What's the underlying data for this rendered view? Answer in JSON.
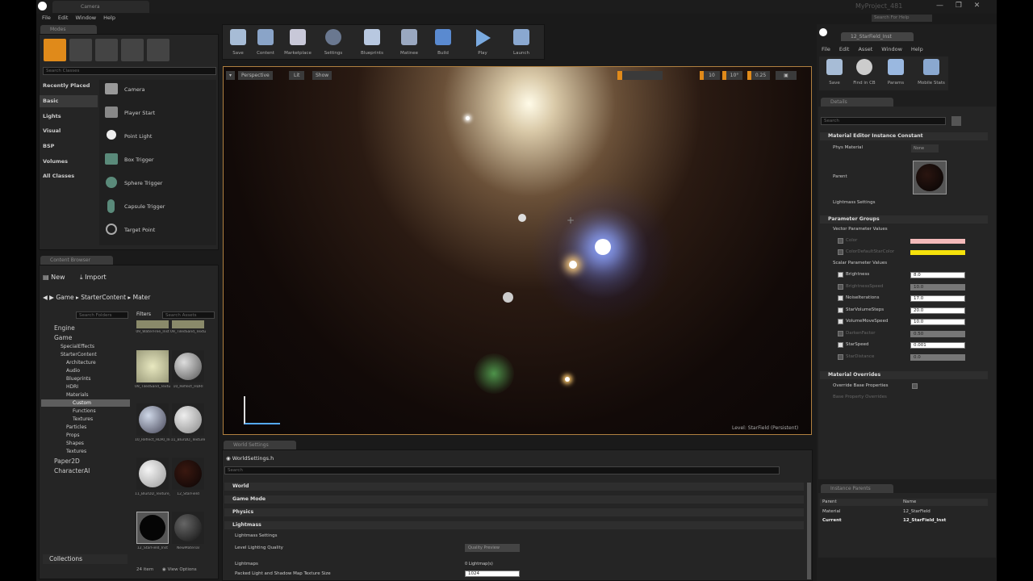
{
  "window": {
    "project_title": "MyProject_481",
    "tab_label": "Camera",
    "search_placeholder": "Search For Help"
  },
  "menu": [
    "File",
    "Edit",
    "Window",
    "Help"
  ],
  "modes": {
    "tab": "Modes",
    "search_placeholder": "Search Classes",
    "categories": [
      "Recently Placed",
      "Basic",
      "Lights",
      "Visual",
      "BSP",
      "Volumes",
      "All Classes"
    ],
    "items": [
      "Camera",
      "Player Start",
      "Point Light",
      "Box Trigger",
      "Sphere Trigger",
      "Capsule Trigger",
      "Target Point"
    ]
  },
  "content_browser": {
    "tab": "Content Browser",
    "new_label": "New",
    "import_label": "Import",
    "path": [
      "Game",
      "StarterContent",
      "Mater"
    ],
    "search_folders": "Search Folders",
    "filters": "Filters",
    "search_assets": "Search Assets",
    "tree": [
      "Engine",
      "Game",
      "SpecialEffects",
      "StarterContent",
      "Architecture",
      "Audio",
      "Blueprints",
      "HDRI",
      "Materials",
      "Custom",
      "Functions",
      "Textures",
      "Particles",
      "Props",
      "Shapes",
      "Textures",
      "Paper2D",
      "CharacterAI"
    ],
    "collections": "Collections",
    "item_count": "24 item",
    "view_options": "View Options",
    "assets": [
      "09_WaterFree_Inst",
      "09_TiledSand_Texture",
      "09_TiledSand_Texture_Inst",
      "10_Reflect_HDRI",
      "10_Reflect_HDRI_Inst",
      "11_BlurDD_Texture",
      "11_BlurDD_Texture_Inst",
      "12_StarField",
      "12_StarField_Inst",
      "NewMaterial"
    ]
  },
  "toolbar": [
    "Save",
    "Content",
    "Marketplace",
    "Settings",
    "Blueprints",
    "Matinee",
    "Build",
    "Play",
    "Launch"
  ],
  "viewport": {
    "perspective": "Perspective",
    "lit": "Lit",
    "show": "Show",
    "level_label": "Level:  StarField (Persistent)",
    "snap_values": [
      "10",
      "10°",
      "0.25"
    ]
  },
  "world_settings": {
    "tab": "World Settings",
    "object": "WorldSettings.h",
    "search_placeholder": "Search",
    "sections": [
      "World",
      "Game Mode",
      "Physics",
      "Lightmass"
    ],
    "lightmass_settings": "Lightmass Settings",
    "level_lighting_quality": "Level Lighting Quality",
    "quality_value": "Quality Preview",
    "lightmaps": "Lightmaps",
    "lightmaps_value": "0 Lightmap(s)",
    "texture_size_label": "Packed Light and Shadow Map Texture Size",
    "texture_size_value": "1024"
  },
  "material_editor": {
    "tab": "12_StarField_Inst",
    "menu": [
      "File",
      "Edit",
      "Asset",
      "Window",
      "Help"
    ],
    "toolbar": [
      "Save",
      "Find in CB",
      "Params",
      "Mobile Stats"
    ],
    "details_tab": "Details",
    "search_placeholder": "Search",
    "section_constant": "Material Editor Instance Constant",
    "phys_material": "Phys Material",
    "phys_value": "None",
    "parent": "Parent",
    "lightmass_settings": "Lightmass Settings",
    "section_params": "Parameter Groups",
    "vector_params": "Vector Parameter Values",
    "vector_items": [
      "Color",
      "ColorDefaultStarColor"
    ],
    "scalar_params": "Scalar Parameter Values",
    "scalar_items": [
      {
        "name": "Brightness",
        "value": "8.0",
        "on": true
      },
      {
        "name": "BrightnessSpeed",
        "value": "10.0",
        "on": false
      },
      {
        "name": "NoiseIterations",
        "value": "17.0",
        "on": true
      },
      {
        "name": "StarVolumeSteps",
        "value": "20.0",
        "on": true
      },
      {
        "name": "VolumeMoveSpeed",
        "value": "10.0",
        "on": true
      },
      {
        "name": "DarkenFactor",
        "value": "0.50",
        "on": false
      },
      {
        "name": "StarSpeed",
        "value": "0.001",
        "on": true
      },
      {
        "name": "StarDistance",
        "value": "0.0",
        "on": false
      }
    ],
    "section_overrides": "Material Overrides",
    "override_base": "Override Base Properties",
    "base_overrides": "Base Property Overrides",
    "instance_parents_tab": "Instance Parents",
    "ip_headers": [
      "Parent",
      "Name"
    ],
    "ip_rows": [
      {
        "type": "Material",
        "name": "12_StarField"
      },
      {
        "type": "Current",
        "name": "12_StarField_Inst"
      }
    ]
  },
  "colors": {
    "accent": "#e08a1a",
    "vector1": "#f4b9b9",
    "vector2": "#f5e10b"
  }
}
